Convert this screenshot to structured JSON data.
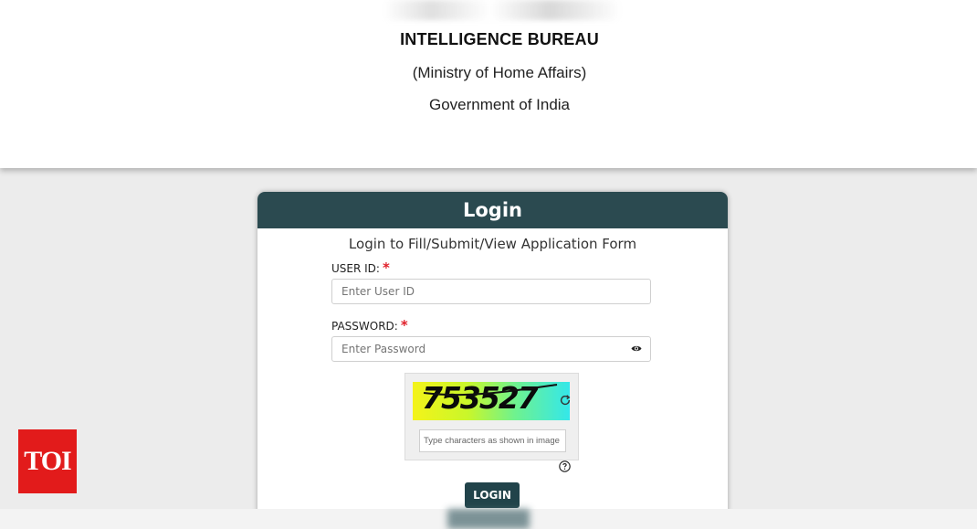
{
  "header": {
    "title": "INTELLIGENCE BUREAU",
    "subtitle": "(Ministry of Home Affairs)",
    "government": "Government of India"
  },
  "login_card": {
    "heading": "Login",
    "subheading": "Login to Fill/Submit/View Application Form",
    "user_id_label": "USER ID:",
    "user_id_placeholder": "Enter User ID",
    "password_label": "PASSWORD:",
    "password_placeholder": "Enter Password",
    "required_mark": "*",
    "captcha_text": "753527",
    "captcha_placeholder": "Type characters as shown in image",
    "login_button": "LOGIN"
  },
  "watermark": {
    "logo_text": "TOI"
  },
  "colors": {
    "header_bar": "#2b4a50",
    "button": "#21434a",
    "required": "#e0202a",
    "watermark": "#e21b1b"
  },
  "icons": [
    "eye-icon",
    "refresh-icon",
    "help-icon"
  ]
}
